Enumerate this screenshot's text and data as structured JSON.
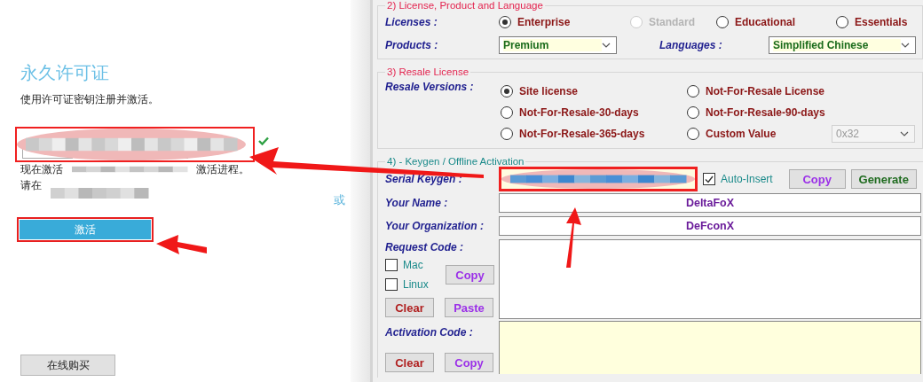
{
  "left_panel": {
    "title": "永久许可证",
    "subtitle": "使用许可证密钥注册并激活。",
    "status_line_1_start": "现在激活",
    "status_line_1_end": "激活进程。",
    "status_line_2_start": "请在",
    "or_link": "或",
    "activate_button": "激活",
    "buy_online_button": "在线购买"
  },
  "license_group": {
    "title": "2) License, Product and Language",
    "licenses_label": "Licenses :",
    "licenses": [
      {
        "label": "Enterprise",
        "selected": true,
        "disabled": false
      },
      {
        "label": "Standard",
        "selected": false,
        "disabled": true
      },
      {
        "label": "Educational",
        "selected": false,
        "disabled": false
      },
      {
        "label": "Essentials",
        "selected": false,
        "disabled": false
      }
    ],
    "products_label": "Products :",
    "product": "Premium",
    "languages_label": "Languages :",
    "language": "Simplified Chinese"
  },
  "resale_group": {
    "title": "3) Resale License",
    "label": "Resale Versions :",
    "options": [
      {
        "label": "Site license",
        "selected": true
      },
      {
        "label": "Not-For-Resale License",
        "selected": false
      },
      {
        "label": "Not-For-Resale-30-days",
        "selected": false
      },
      {
        "label": "Not-For-Resale-90-days",
        "selected": false
      },
      {
        "label": "Not-For-Resale-365-days",
        "selected": false
      },
      {
        "label": "Custom Value",
        "selected": false
      }
    ],
    "custom_value": "0x32"
  },
  "keygen_group": {
    "title": "4) - Keygen / Offline Activation",
    "serial_label": "Serial Keygen :",
    "auto_insert": {
      "label": "Auto-Insert",
      "checked": true
    },
    "serial_buttons": [
      {
        "label": "Copy",
        "kind": "copy"
      },
      {
        "label": "Generate",
        "kind": "generate"
      }
    ],
    "name_label": "Your Name :",
    "name": "DeltaFoX",
    "organization_label": "Your Organization :",
    "organization": "DeFconX",
    "request_label": "Request Code :",
    "platforms": [
      {
        "label": "Mac",
        "checked": false
      },
      {
        "label": "Linux",
        "checked": false
      }
    ],
    "request_copy_button": {
      "label": "Copy",
      "kind": "copy"
    },
    "request_buttons": [
      {
        "label": "Clear",
        "kind": "clear"
      },
      {
        "label": "Paste",
        "kind": "paste"
      }
    ],
    "activation_label": "Activation Code :",
    "activation_buttons": [
      {
        "label": "Clear",
        "kind": "clear"
      },
      {
        "label": "Copy",
        "kind": "copy"
      }
    ]
  }
}
